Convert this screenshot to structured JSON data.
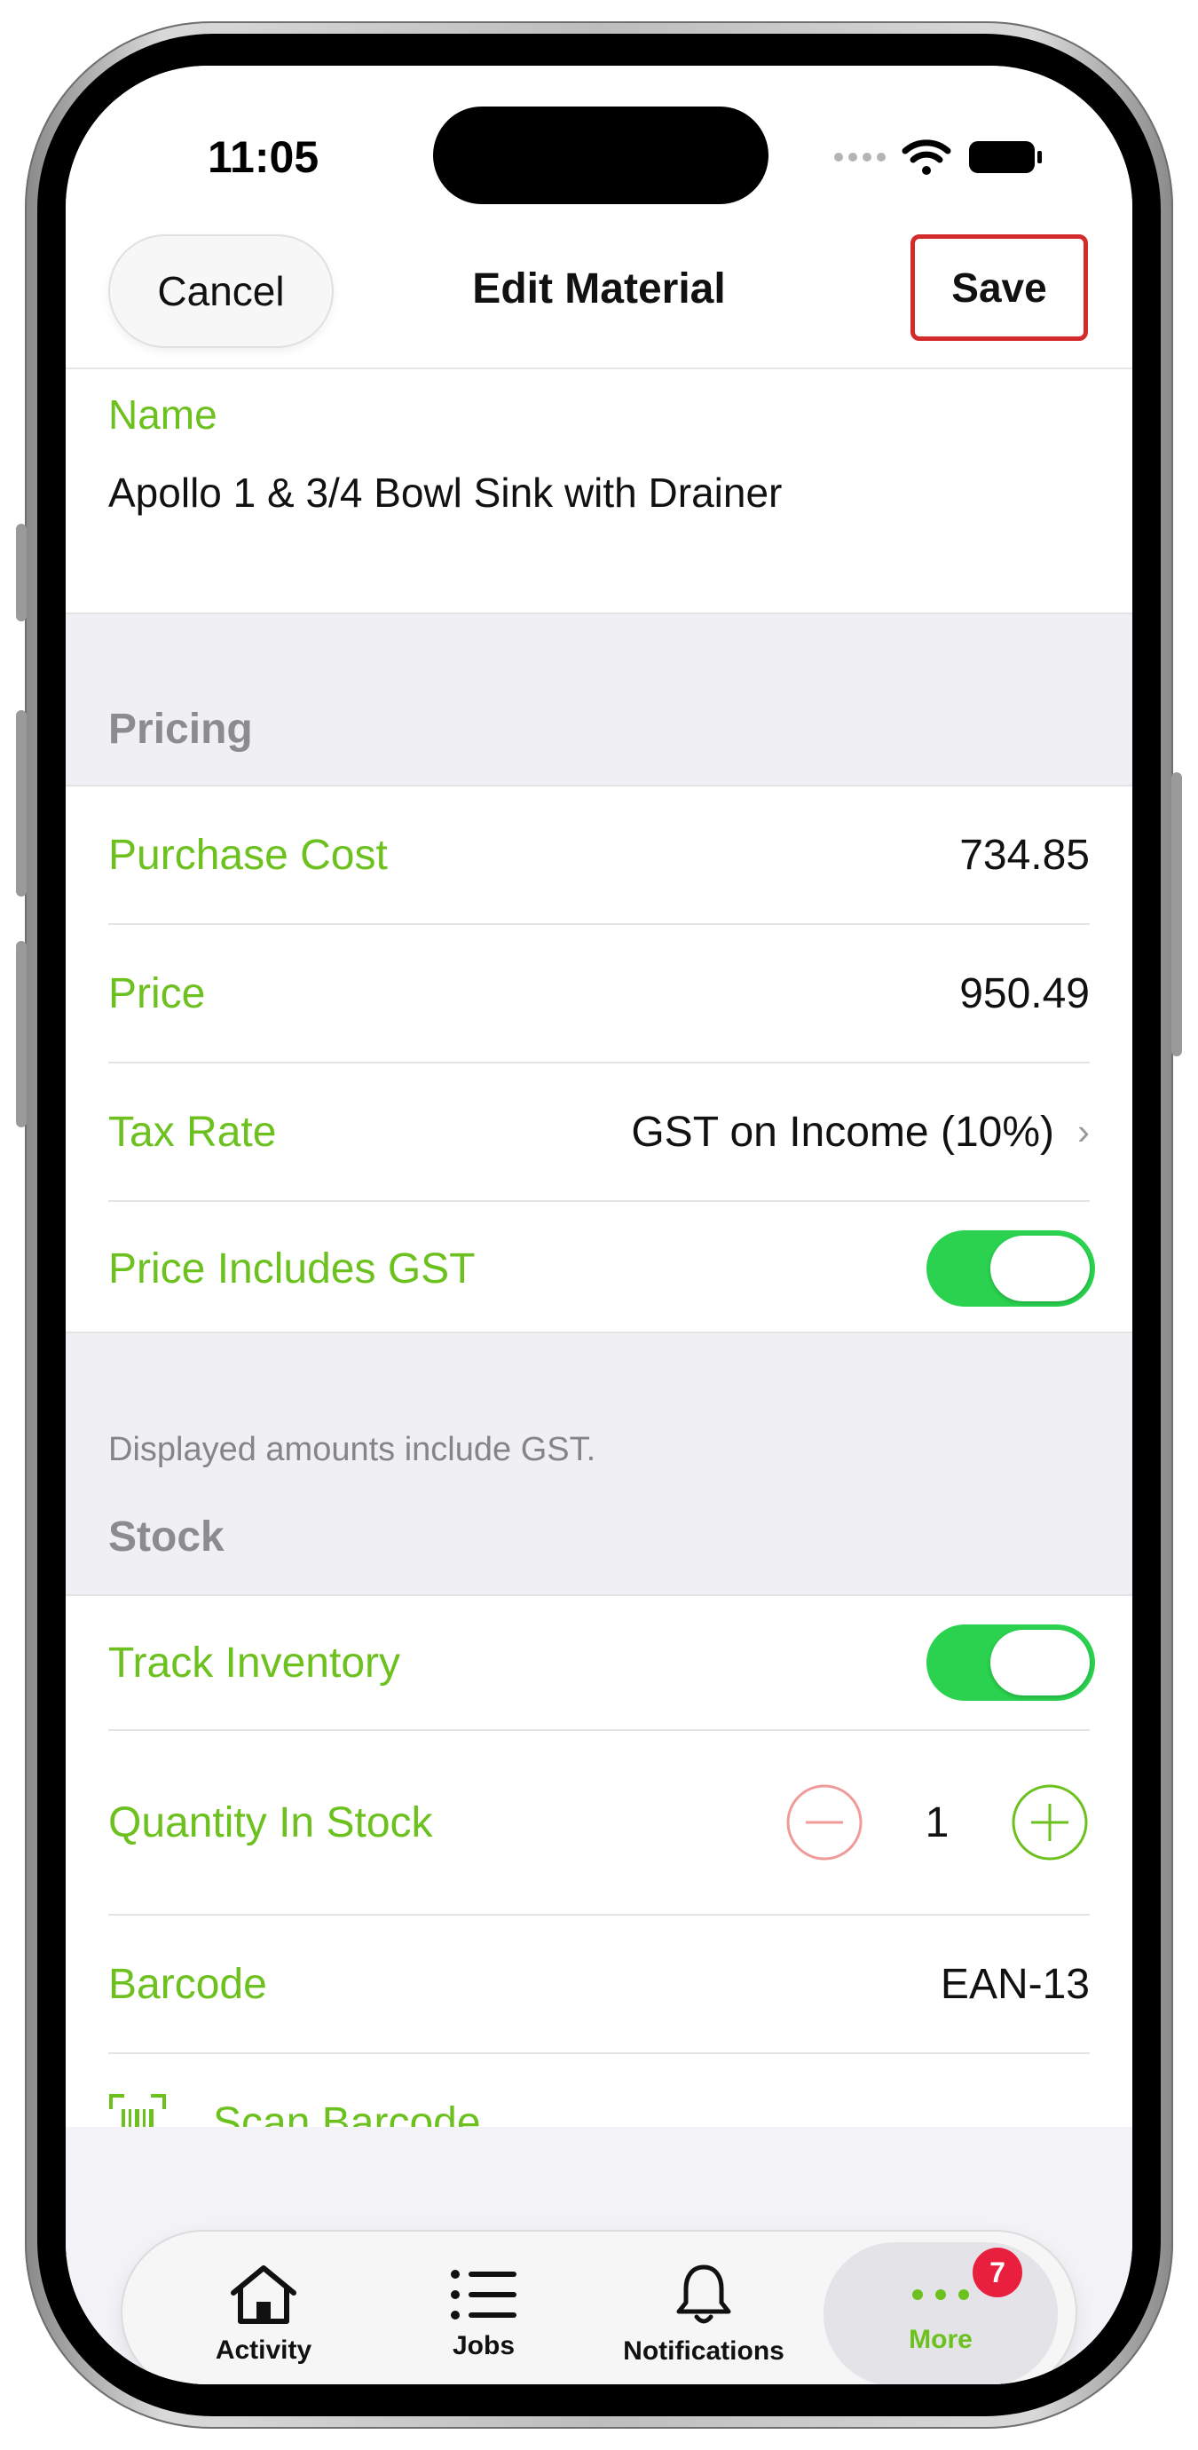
{
  "status": {
    "time": "11:05"
  },
  "nav": {
    "cancel_label": "Cancel",
    "title": "Edit Material",
    "save_label": "Save"
  },
  "name": {
    "label": "Name",
    "value": "Apollo 1 & 3/4 Bowl Sink with Drainer"
  },
  "pricing": {
    "header": "Pricing",
    "purchase_cost_label": "Purchase Cost",
    "purchase_cost_value": "734.85",
    "price_label": "Price",
    "price_value": "950.49",
    "tax_rate_label": "Tax Rate",
    "tax_rate_value": "GST on Income (10%)",
    "includes_gst_label": "Price Includes GST",
    "includes_gst_on": true,
    "footnote": "Displayed amounts include GST."
  },
  "stock": {
    "header": "Stock",
    "track_inventory_label": "Track Inventory",
    "track_inventory_on": true,
    "quantity_label": "Quantity In Stock",
    "quantity_value": "1",
    "barcode_label": "Barcode",
    "barcode_value": "EAN-13",
    "scan_label": "Scan Barcode"
  },
  "tabbar": {
    "tabs": [
      {
        "label": "Activity",
        "icon": "home-icon"
      },
      {
        "label": "Jobs",
        "icon": "list-icon"
      },
      {
        "label": "Notifications",
        "icon": "bell-icon"
      },
      {
        "label": "More",
        "icon": "more-dots-icon",
        "badge": "7",
        "active": true
      }
    ]
  },
  "colors": {
    "accent_green": "#6cc11f",
    "toggle_green": "#2ad24f",
    "badge_red": "#e8203e",
    "highlight_red": "#d32b2b",
    "minus_red": "#f09a9a"
  }
}
